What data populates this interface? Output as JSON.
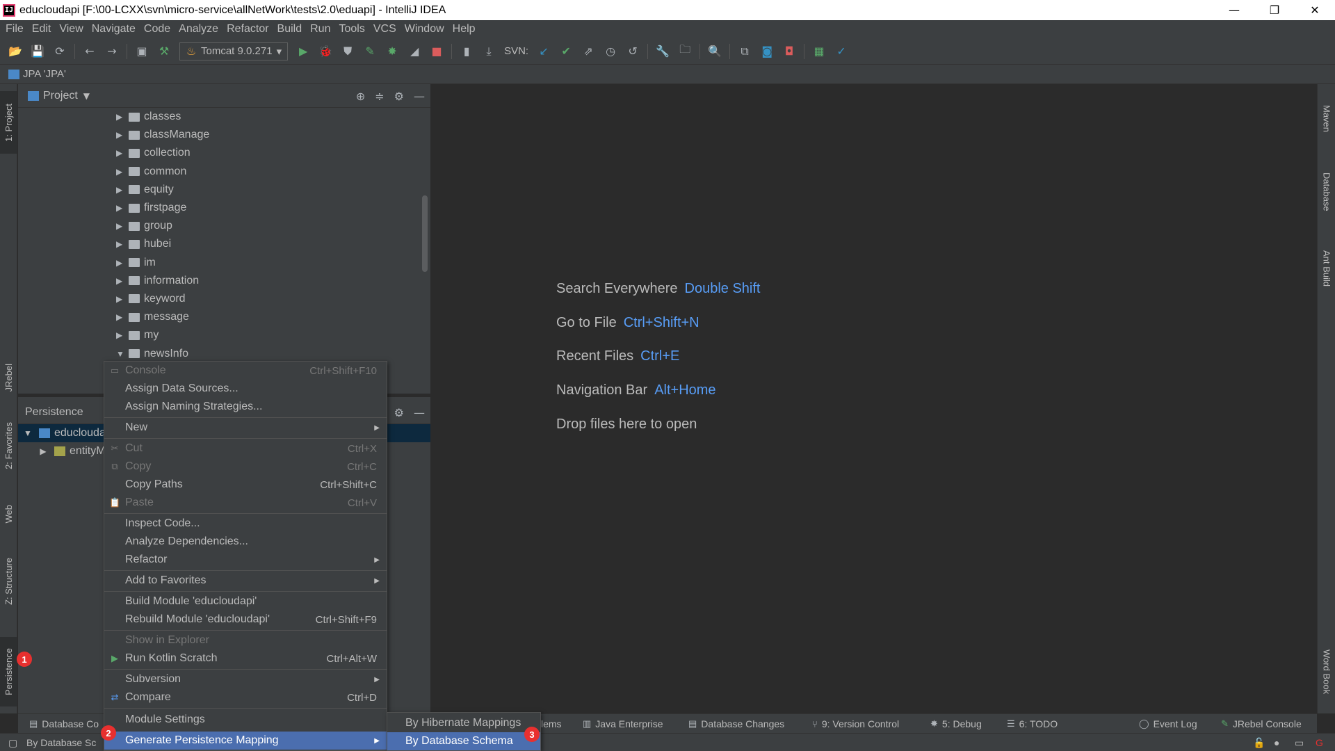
{
  "window": {
    "title": "educloudapi [F:\\00-LCXX\\svn\\micro-service\\allNetWork\\tests\\2.0\\eduapi] - IntelliJ IDEA",
    "app_icon_text": "IJ",
    "minimize": "—",
    "maximize": "❐",
    "close": "✕"
  },
  "menubar": [
    "File",
    "Edit",
    "View",
    "Navigate",
    "Code",
    "Analyze",
    "Refactor",
    "Build",
    "Run",
    "Tools",
    "VCS",
    "Window",
    "Help"
  ],
  "toolbar": {
    "run_config": "Tomcat 9.0.271",
    "svn_label": "SVN:"
  },
  "navbar": {
    "text": "JPA 'JPA'"
  },
  "left_tabs": {
    "project": "1: Project",
    "jrebel": "JRebel",
    "favorites": "2: Favorites",
    "web": "Web",
    "structure": "Z: Structure",
    "persistence": "Persistence"
  },
  "right_tabs": {
    "maven": "Maven",
    "database": "Database",
    "ant": "Ant Build",
    "wordbook": "Word Book"
  },
  "project_panel": {
    "title": "Project",
    "folders": [
      {
        "name": "classes",
        "expanded": false
      },
      {
        "name": "classManage",
        "expanded": false
      },
      {
        "name": "collection",
        "expanded": false
      },
      {
        "name": "common",
        "expanded": false
      },
      {
        "name": "equity",
        "expanded": false
      },
      {
        "name": "firstpage",
        "expanded": false
      },
      {
        "name": "group",
        "expanded": false
      },
      {
        "name": "hubei",
        "expanded": false
      },
      {
        "name": "im",
        "expanded": false
      },
      {
        "name": "information",
        "expanded": false
      },
      {
        "name": "keyword",
        "expanded": false
      },
      {
        "name": "message",
        "expanded": false
      },
      {
        "name": "my",
        "expanded": false
      },
      {
        "name": "newsInfo",
        "expanded": true
      }
    ]
  },
  "persistence_panel": {
    "title": "Persistence",
    "root": "educlouda",
    "child": "entityM"
  },
  "editor_hints": [
    {
      "label": "Search Everywhere",
      "key": "Double Shift"
    },
    {
      "label": "Go to File",
      "key": "Ctrl+Shift+N"
    },
    {
      "label": "Recent Files",
      "key": "Ctrl+E"
    },
    {
      "label": "Navigation Bar",
      "key": "Alt+Home"
    },
    {
      "label": "Drop files here to open",
      "key": ""
    }
  ],
  "context_menu": {
    "items": [
      {
        "label": "Console",
        "shortcut": "Ctrl+Shift+F10",
        "disabled": true
      },
      {
        "label": "Assign Data Sources...",
        "shortcut": ""
      },
      {
        "label": "Assign Naming Strategies...",
        "shortcut": ""
      },
      {
        "label": "New",
        "shortcut": ""
      },
      {
        "label": "Cut",
        "shortcut": "Ctrl+X",
        "disabled": true
      },
      {
        "label": "Copy",
        "shortcut": "Ctrl+C",
        "disabled": true
      },
      {
        "label": "Copy Paths",
        "shortcut": "Ctrl+Shift+C"
      },
      {
        "label": "Paste",
        "shortcut": "Ctrl+V",
        "disabled": true
      },
      {
        "label": "Inspect Code...",
        "shortcut": ""
      },
      {
        "label": "Analyze Dependencies...",
        "shortcut": ""
      },
      {
        "label": "Refactor",
        "shortcut": ""
      },
      {
        "label": "Add to Favorites",
        "shortcut": ""
      },
      {
        "label": "Build Module 'educloudapi'",
        "shortcut": ""
      },
      {
        "label": "Rebuild Module 'educloudapi'",
        "shortcut": "Ctrl+Shift+F9"
      },
      {
        "label": "Show in Explorer",
        "shortcut": "",
        "disabled": true
      },
      {
        "label": "Run Kotlin Scratch",
        "shortcut": "Ctrl+Alt+W"
      },
      {
        "label": "Subversion",
        "shortcut": ""
      },
      {
        "label": "Compare",
        "shortcut": "Ctrl+D"
      },
      {
        "label": "Module Settings",
        "shortcut": ""
      },
      {
        "label": "Generate Persistence Mapping",
        "shortcut": "",
        "highlighted": true
      }
    ]
  },
  "submenu": {
    "items": [
      {
        "label": "By Hibernate Mappings"
      },
      {
        "label": "By Database Schema",
        "highlighted": true
      }
    ]
  },
  "bottom_tools": {
    "database_console": "Database Co",
    "problems": "lems",
    "java_enterprise": "Java Enterprise",
    "database_changes": "Database Changes",
    "version_control": "9: Version Control",
    "debug": "5: Debug",
    "todo": "6: TODO",
    "event_log": "Event Log",
    "jrebel_console": "JRebel Console"
  },
  "statusbar": {
    "text": "By Database Sc"
  },
  "badges": [
    "1",
    "2",
    "3"
  ],
  "colors": {
    "background": "#2b2b2b",
    "panel": "#3c3f41",
    "highlight": "#4b6eaf",
    "shortcut_blue": "#589df6",
    "badge_red": "#e8302f"
  }
}
